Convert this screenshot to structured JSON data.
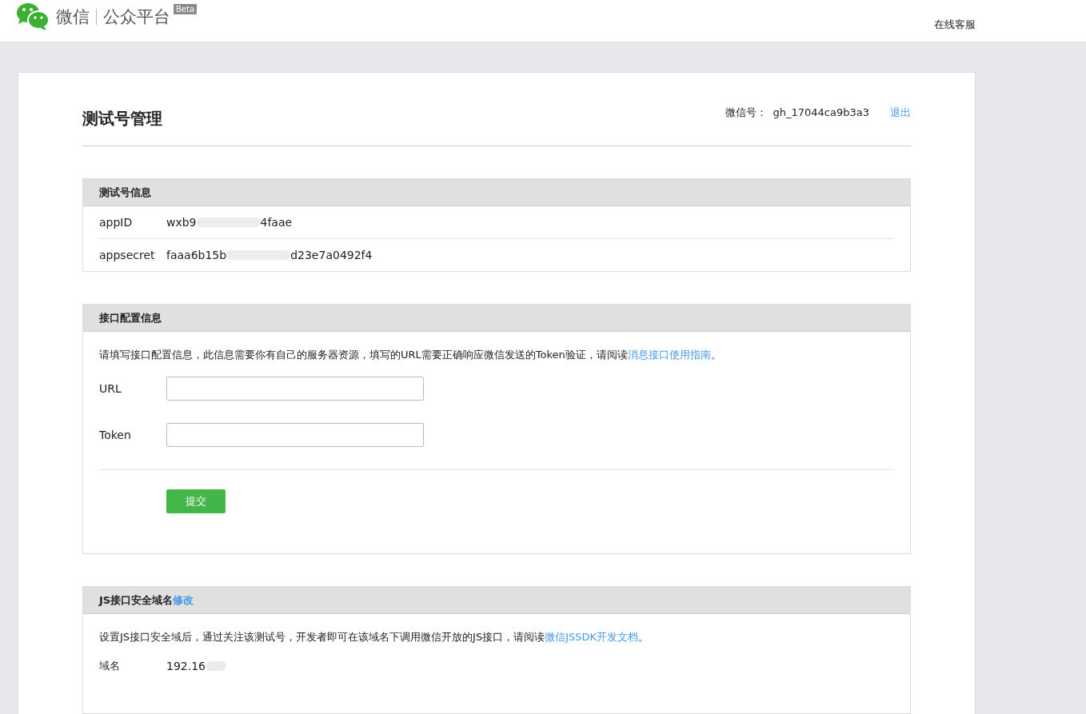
{
  "header": {
    "brand": "微信",
    "product": "公众平台",
    "badge": "Beta",
    "service_link": "在线客服"
  },
  "page": {
    "title": "测试号管理",
    "account_label": "微信号：",
    "account_id": "gh_17044ca9b3a3",
    "logout": "退出"
  },
  "test_account": {
    "title": "测试号信息",
    "rows": [
      {
        "label": "appID",
        "value_parts": [
          "wxb9",
          "4faae"
        ]
      },
      {
        "label": "appsecret",
        "value_parts": [
          "faaa6b15b",
          "d23e7a0492f4"
        ]
      }
    ]
  },
  "interface_config": {
    "title": "接口配置信息",
    "intro": "请填写接口配置信息，此信息需要你有自己的服务器资源，填写的URL需要正确响应微信发送的Token验证，请阅读",
    "intro_link": "消息接口使用指南",
    "intro_end": "。",
    "fields": [
      {
        "label": "URL"
      },
      {
        "label": "Token"
      }
    ],
    "submit": "提交"
  },
  "js_domain": {
    "title": "JS接口安全域名",
    "edit_link": "修改",
    "intro": "设置JS接口安全域后，通过关注该测试号，开发者即可在该域名下调用微信开放的JS接口，请阅读",
    "intro_link": "微信JSSDK开发文档",
    "intro_end": "。",
    "label": "域名",
    "value_parts": [
      "192.16"
    ]
  }
}
